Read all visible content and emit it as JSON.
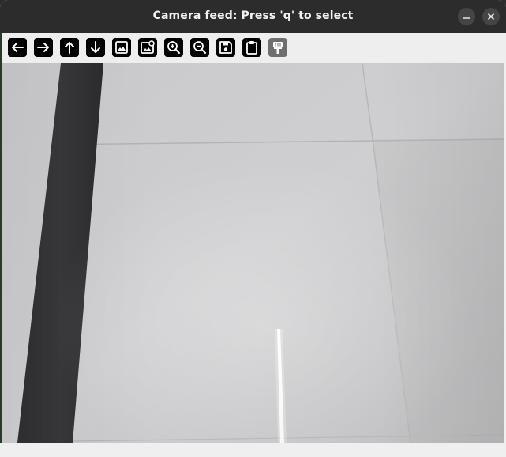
{
  "window": {
    "title": "Camera feed: Press 'q' to select"
  },
  "window_controls": [
    "minimize",
    "close"
  ],
  "toolbar": {
    "buttons": [
      {
        "icon": "arrow-left-icon",
        "enabled": true
      },
      {
        "icon": "arrow-right-icon",
        "enabled": true
      },
      {
        "icon": "arrow-up-icon",
        "enabled": true
      },
      {
        "icon": "arrow-down-icon",
        "enabled": true
      },
      {
        "icon": "image-icon",
        "enabled": true
      },
      {
        "icon": "image-settings-icon",
        "enabled": true
      },
      {
        "icon": "zoom-in-icon",
        "enabled": true
      },
      {
        "icon": "zoom-out-icon",
        "enabled": true
      },
      {
        "icon": "save-icon",
        "enabled": true
      },
      {
        "icon": "clipboard-icon",
        "enabled": true
      },
      {
        "icon": "paint-brush-icon",
        "enabled": false
      }
    ]
  },
  "feed": {
    "content": "camera image of a light tiled floor with a dark stripe"
  },
  "colors": {
    "titlebar": "#2c2c2c",
    "title_text": "#f2f2f2",
    "toolbar": "#eeeeee",
    "icon_button": "#000000",
    "icon_button_disabled": "#6f6f6f"
  }
}
